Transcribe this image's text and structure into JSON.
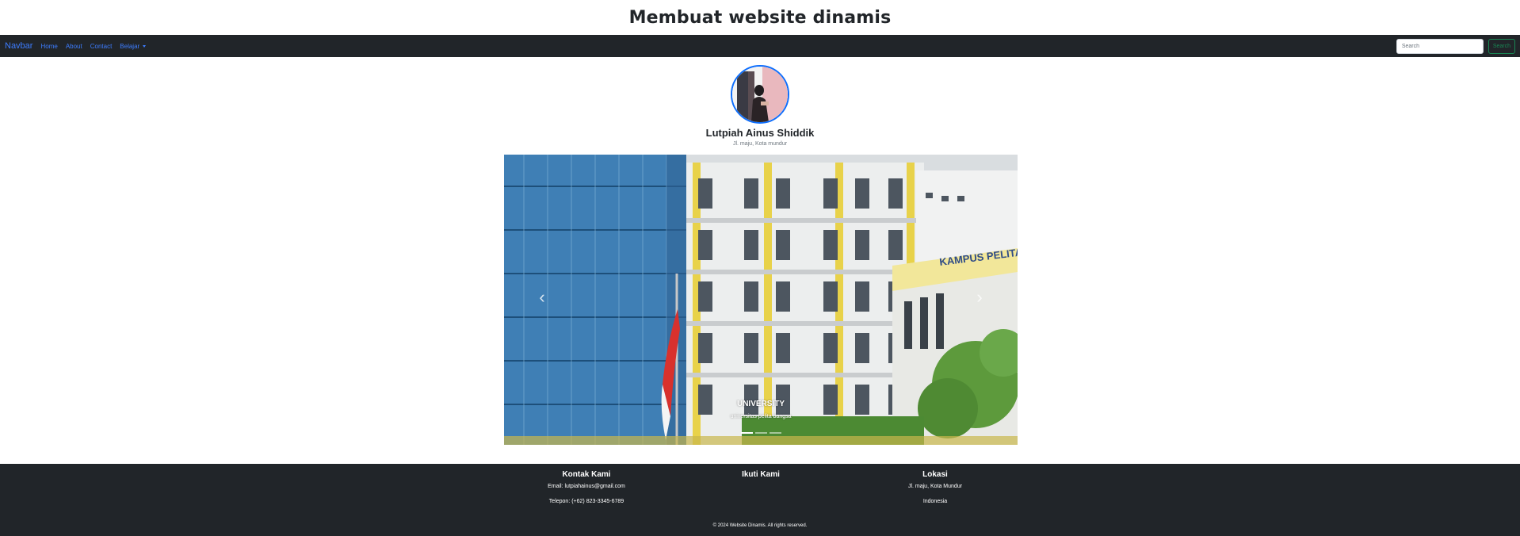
{
  "page": {
    "title": "Membuat website dinamis"
  },
  "navbar": {
    "brand": "Navbar",
    "links": [
      "Home",
      "About",
      "Contact",
      "Belajar"
    ],
    "search_placeholder": "Search",
    "search_button": "Search"
  },
  "profile": {
    "name": "Lutpiah Ainus Shiddik",
    "address": "Jl. maju, Kota mundur"
  },
  "carousel": {
    "caption_title": "UNIVERSITY",
    "caption_text": "universitas pelita bangsa",
    "sign_text": "KAMPUS PELITA",
    "slides": 3,
    "active_slide": 1,
    "prev_icon": "chevron-left-icon",
    "next_icon": "chevron-right-icon"
  },
  "footer": {
    "contact": {
      "heading": "Kontak Kami",
      "email": "Email: lutpiahainus@gmail.com",
      "phone": "Telepon: (+62) 823-3345-6789"
    },
    "follow": {
      "heading": "Ikuti Kami"
    },
    "location": {
      "heading": "Lokasi",
      "address": "Jl. maju, Kota Mundur",
      "country": "Indonesia"
    },
    "copyright": "© 2024 Website Dinamis. All rights reserved."
  },
  "colors": {
    "navbar_bg": "#212529",
    "link": "#3d7dff",
    "search_button": "#198754",
    "avatar_border": "#0d6efd"
  }
}
